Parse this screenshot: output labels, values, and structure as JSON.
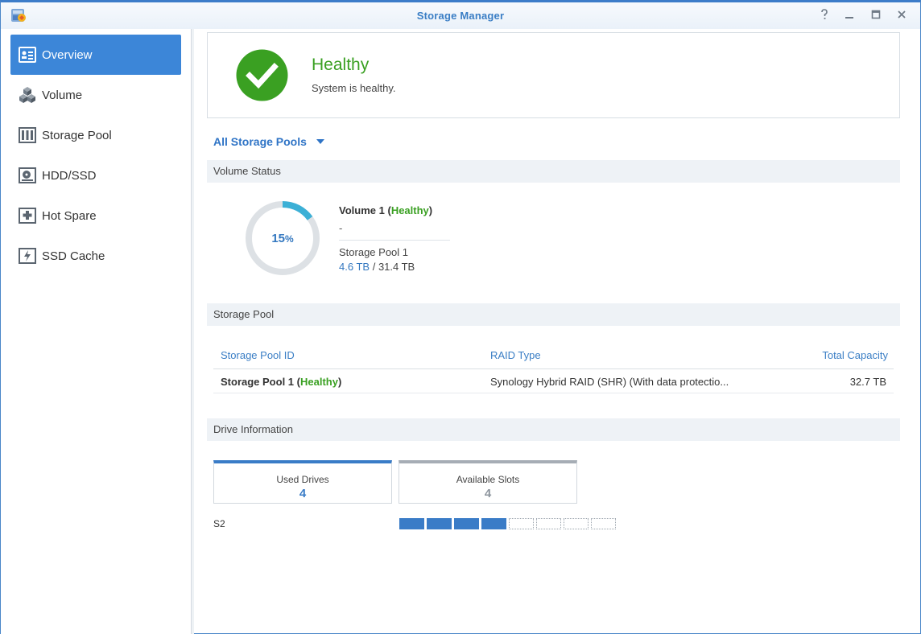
{
  "window": {
    "title": "Storage Manager"
  },
  "sidebar": {
    "items": [
      {
        "label": "Overview",
        "icon": "overview-icon",
        "active": true
      },
      {
        "label": "Volume",
        "icon": "volume-icon",
        "active": false
      },
      {
        "label": "Storage Pool",
        "icon": "storage-pool-icon",
        "active": false
      },
      {
        "label": "HDD/SSD",
        "icon": "hdd-icon",
        "active": false
      },
      {
        "label": "Hot Spare",
        "icon": "hot-spare-icon",
        "active": false
      },
      {
        "label": "SSD Cache",
        "icon": "ssd-cache-icon",
        "active": false
      }
    ]
  },
  "health": {
    "title": "Healthy",
    "subtitle": "System is healthy.",
    "color": "#3aa022"
  },
  "filter": {
    "label": "All Storage Pools"
  },
  "volume_status": {
    "header": "Volume Status",
    "percent": "15",
    "percent_unit": "%",
    "usage_fraction": 0.15,
    "volume_name": "Volume 1",
    "open_paren": "(",
    "status": "Healthy",
    "close_paren": ")",
    "description": "-",
    "pool": "Storage Pool 1",
    "used": "4.6 TB",
    "separator": "/",
    "total": "31.4 TB",
    "accent": "#3cb0d6"
  },
  "storage_pool": {
    "header": "Storage Pool",
    "columns": [
      "Storage Pool ID",
      "RAID Type",
      "Total Capacity"
    ],
    "rows": [
      {
        "id": "Storage Pool 1",
        "open_paren": "(",
        "status": "Healthy",
        "close_paren": ")",
        "raid": "Synology Hybrid RAID (SHR) (With data protectio...",
        "capacity": "32.7 TB"
      }
    ]
  },
  "drive_info": {
    "header": "Drive Information",
    "used_label": "Used Drives",
    "used_value": "4",
    "avail_label": "Available Slots",
    "avail_value": "4",
    "slot_group": "S2",
    "slots_used": 4,
    "slots_total": 8,
    "used_color": "#3a7cc7"
  }
}
